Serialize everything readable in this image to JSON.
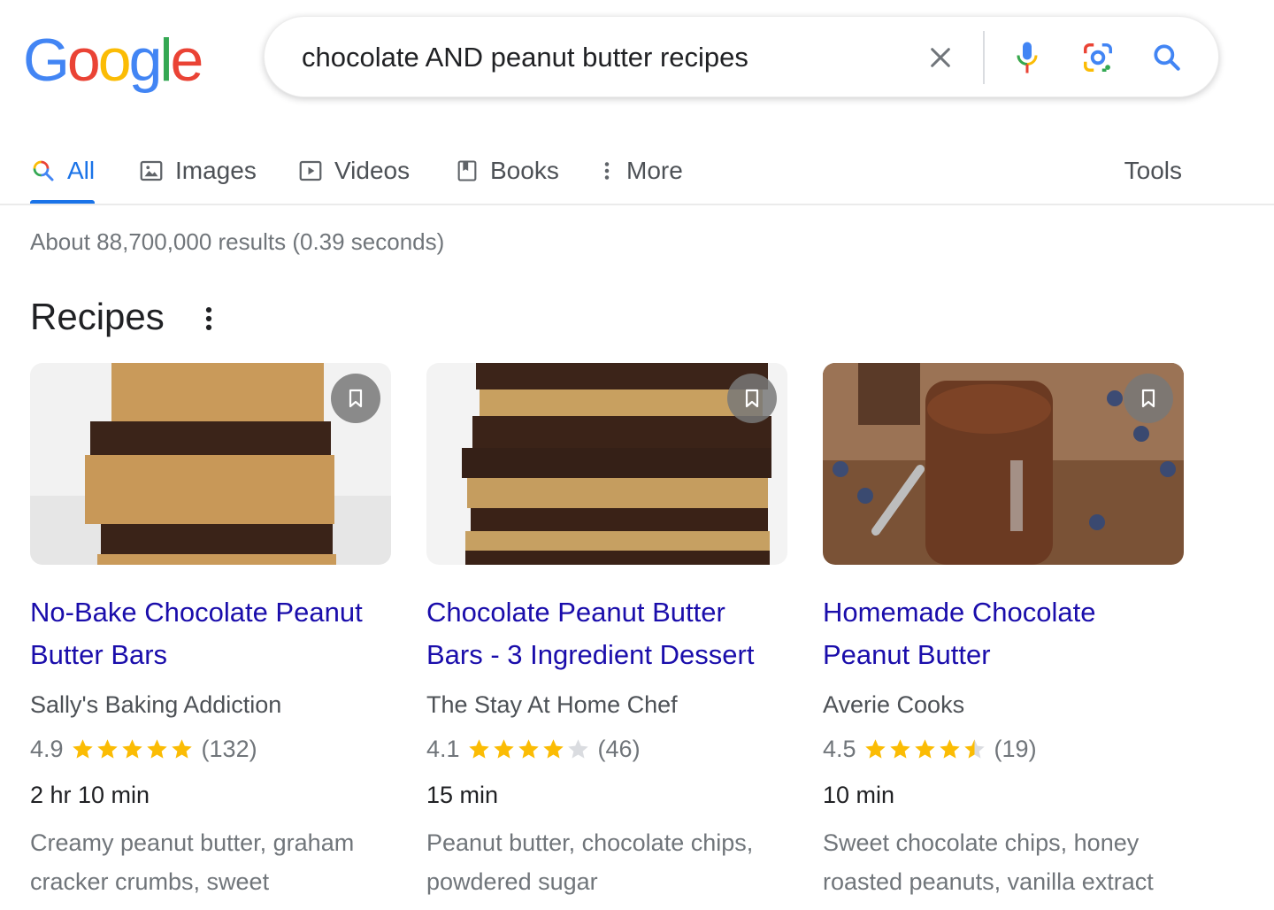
{
  "brand": {
    "logo_letters": [
      {
        "ch": "G",
        "color": "#4285F4"
      },
      {
        "ch": "o",
        "color": "#EA4335"
      },
      {
        "ch": "o",
        "color": "#FBBC05"
      },
      {
        "ch": "g",
        "color": "#4285F4"
      },
      {
        "ch": "l",
        "color": "#34A853"
      },
      {
        "ch": "e",
        "color": "#EA4335"
      }
    ]
  },
  "search": {
    "query": "chocolate AND peanut butter recipes",
    "icons": [
      "close-icon",
      "microphone-icon",
      "lens-icon",
      "search-icon"
    ]
  },
  "tabs": [
    {
      "label": "All",
      "icon": "search-multicolor-icon",
      "active": true
    },
    {
      "label": "Images",
      "icon": "image-icon",
      "active": false
    },
    {
      "label": "Videos",
      "icon": "play-icon",
      "active": false
    },
    {
      "label": "Books",
      "icon": "book-icon",
      "active": false
    },
    {
      "label": "More",
      "icon": "more-vert-icon",
      "active": false
    }
  ],
  "tools_label": "Tools",
  "result_stats": "About 88,700,000 results (0.39 seconds)",
  "recipes": {
    "heading": "Recipes",
    "cards": [
      {
        "title_line1": "No-Bake Chocolate Peanut",
        "title_line2": "Butter Bars",
        "source": "Sally's Baking Addiction",
        "rating": "4.9",
        "stars": 5,
        "reviews": "(132)",
        "time": "2 hr 10 min",
        "desc_line1": "Creamy peanut butter, graham",
        "desc_line2": "cracker crumbs, sweet",
        "image": "peanut-butter-bars-photo"
      },
      {
        "title_line1": "Chocolate Peanut Butter",
        "title_line2": "Bars - 3 Ingredient Dessert",
        "source": "The Stay At Home Chef",
        "rating": "4.1",
        "stars": 4,
        "reviews": "(46)",
        "time": "15 min",
        "desc_line1": "Peanut butter, chocolate chips,",
        "desc_line2": "powdered sugar",
        "image": "layered-bars-photo"
      },
      {
        "title_line1": "Homemade Chocolate",
        "title_line2": "Peanut Butter",
        "source": "Averie Cooks",
        "rating": "4.5",
        "stars": 4.5,
        "reviews": "(19)",
        "time": "10 min",
        "desc_line1": "Sweet chocolate chips, honey",
        "desc_line2": "roasted peanuts, vanilla extract",
        "image": "chocolate-spread-jar-photo"
      }
    ]
  },
  "colors": {
    "link": "#1a0dab",
    "accent": "#1a73e8",
    "star": "#fbbc04",
    "star_empty": "#dadce0"
  }
}
